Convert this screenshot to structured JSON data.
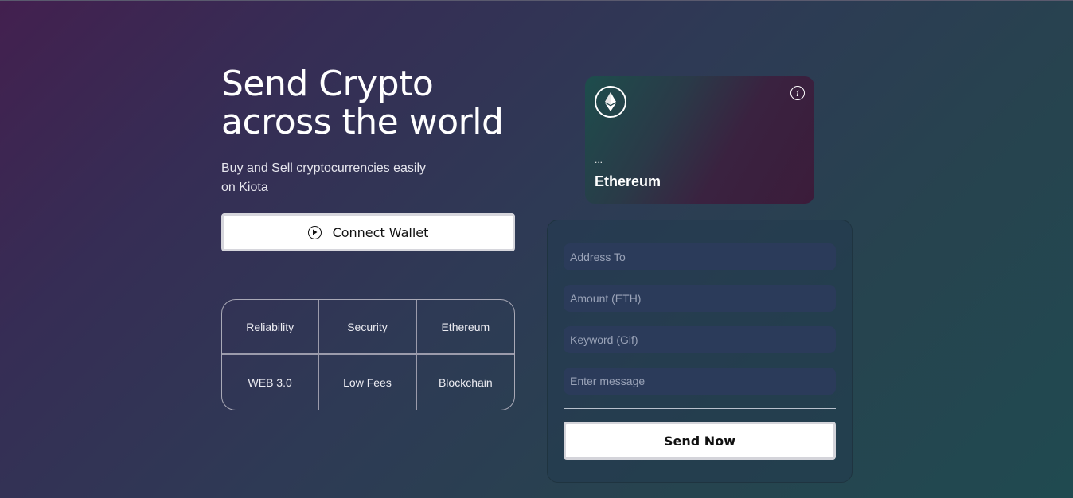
{
  "hero": {
    "title_line1": "Send Crypto",
    "title_line2": "across the world",
    "subtitle_line1": "Buy and Sell cryptocurrencies easily",
    "subtitle_line2": "on Kiota",
    "connect_label": "Connect Wallet"
  },
  "features": [
    "Reliability",
    "Security",
    "Ethereum",
    "WEB 3.0",
    "Low Fees",
    "Blockchain"
  ],
  "card": {
    "address": "...",
    "network": "Ethereum",
    "info_glyph": "i",
    "logo_icon": "ethereum-icon"
  },
  "form": {
    "address_placeholder": "Address To",
    "amount_placeholder": "Amount (ETH)",
    "keyword_placeholder": "Keyword (Gif)",
    "message_placeholder": "Enter message",
    "submit_label": "Send Now"
  },
  "colors": {
    "background_start": "#43204f",
    "background_end": "#204a50",
    "input_bg": "#2b3b5a",
    "button_bg": "#ffffff"
  }
}
